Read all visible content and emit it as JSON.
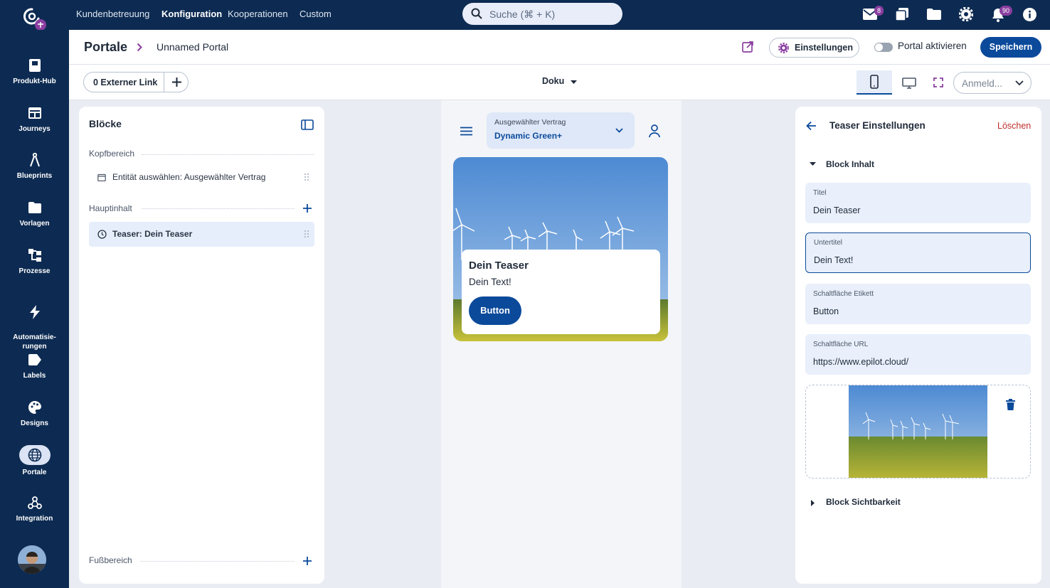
{
  "topnav": {
    "links": [
      "Kundenbetreuung",
      "Konfiguration",
      "Kooperationen",
      "Custom"
    ],
    "search_placeholder": "Suche (⌘ + K)",
    "mail_badge": "8",
    "notification_badge": "90"
  },
  "sidebar": {
    "items": [
      {
        "label": "Produkt-Hub",
        "icon": "box-icon"
      },
      {
        "label": "Journeys",
        "icon": "journey-icon"
      },
      {
        "label": "Blueprints",
        "icon": "compass-icon"
      },
      {
        "label": "Vorlagen",
        "icon": "folder-icon"
      },
      {
        "label": "Prozesse",
        "icon": "process-icon"
      },
      {
        "label": "Automatisie-\nrungen",
        "icon": "bolt-icon"
      },
      {
        "label": "Labels",
        "icon": "label-icon"
      },
      {
        "label": "Designs",
        "icon": "palette-icon"
      },
      {
        "label": "Portale",
        "icon": "globe-icon"
      },
      {
        "label": "Integration",
        "icon": "webhook-icon"
      }
    ]
  },
  "header": {
    "breadcrumb_root": "Portale",
    "breadcrumb_current": "Unnamed Portal",
    "settings_label": "Einstellungen",
    "toggle_label": "Portal aktivieren",
    "save_label": "Speichern"
  },
  "toolbar": {
    "external_link_label": "0 Externer Link",
    "page_select": "Doku",
    "login_select": "Anmeld..."
  },
  "blocks_panel": {
    "title": "Blöcke",
    "header_section": "Kopfbereich",
    "header_item": "Entität auswählen: Ausgewählter Vertrag",
    "main_section": "Hauptinhalt",
    "main_item": "Teaser: Dein Teaser",
    "footer_section": "Fußbereich"
  },
  "preview": {
    "contract_label": "Ausgewählter Vertrag",
    "contract_value": "Dynamic Green+",
    "teaser_title": "Dein Teaser",
    "teaser_text": "Dein Text!",
    "teaser_button": "Button"
  },
  "settings_panel": {
    "title": "Teaser Einstellungen",
    "delete_label": "Löschen",
    "section_content": "Block Inhalt",
    "fields": [
      {
        "label": "Titel",
        "value": "Dein Teaser"
      },
      {
        "label": "Untertitel",
        "value": "Dein Text!"
      },
      {
        "label": "Schaltfläche Etikett",
        "value": "Button"
      },
      {
        "label": "Schaltfläche URL",
        "value": "https://www.epilot.cloud/"
      }
    ],
    "section_visibility": "Block Sichtbarkeit"
  },
  "colors": {
    "navy": "#0d2b52",
    "primary": "#0b4a9b",
    "danger": "#c0302e",
    "accent_purple": "#8a3ea0"
  }
}
